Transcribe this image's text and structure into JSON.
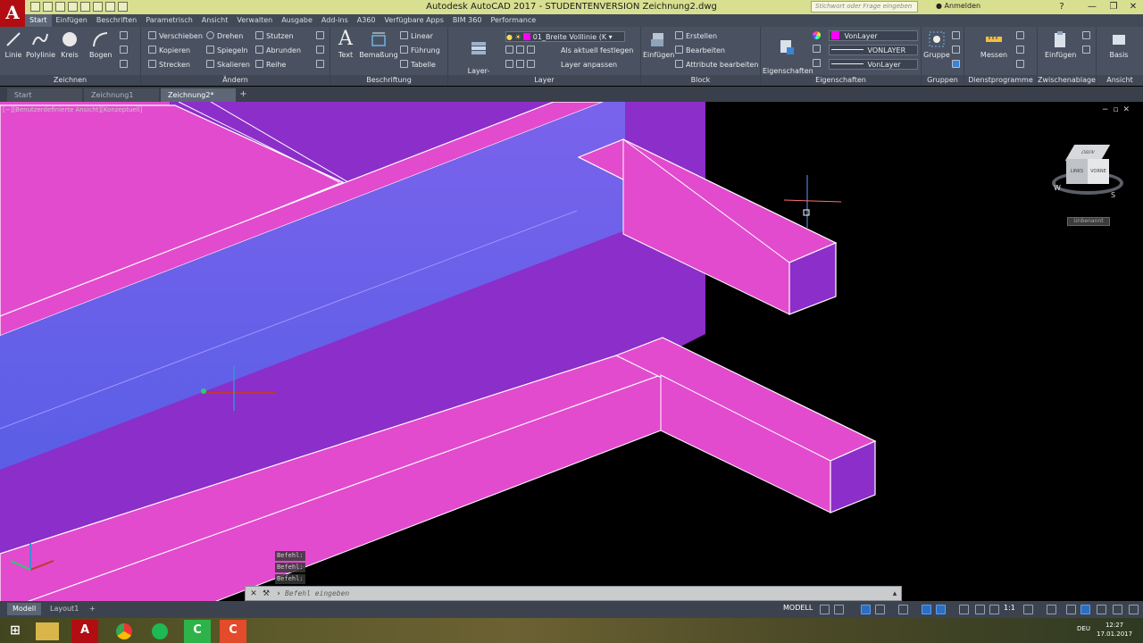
{
  "title_bar": {
    "app_logo": "A",
    "title": "Autodesk AutoCAD 2017 - STUDENTENVERSION    Zeichnung2.dwg",
    "search_placeholder": "Stichwort oder Frage eingeben",
    "signin_label": "Anmelden",
    "help_label": "?",
    "minimize": "—",
    "maximize": "❐",
    "close": "✕"
  },
  "ribbon_tabs": [
    "Start",
    "Einfügen",
    "Beschriften",
    "Parametrisch",
    "Ansicht",
    "Verwalten",
    "Ausgabe",
    "Add-ins",
    "A360",
    "Verfügbare Apps",
    "BIM 360",
    "Performance"
  ],
  "ribbon": {
    "zeichnen": {
      "title": "Zeichnen",
      "linie": "Linie",
      "polylinie": "Polylinie",
      "kreis": "Kreis",
      "bogen": "Bogen"
    },
    "aendern": {
      "title": "Ändern",
      "verschieben": "Verschieben",
      "drehen": "Drehen",
      "stutzen": "Stutzen",
      "kopieren": "Kopieren",
      "spiegeln": "Spiegeln",
      "abrunden": "Abrunden",
      "strecken": "Strecken",
      "skalieren": "Skalieren",
      "reihe": "Reihe"
    },
    "beschriftung": {
      "title": "Beschriftung",
      "text": "Text",
      "bemassung": "Bemaßung",
      "linear": "Linear",
      "fuehrung": "Führung",
      "tabelle": "Tabelle"
    },
    "layer": {
      "title": "Layer",
      "layer_eigenschaften": "Layer-\nEigenschaften",
      "current_layer": "01_Breite Volllinie (K",
      "als_aktuell": "Als aktuell festlegen",
      "layer_anpassen": "Layer anpassen"
    },
    "block": {
      "title": "Block",
      "einfuegen": "Einfügen",
      "erstellen": "Erstellen",
      "bearbeiten": "Bearbeiten",
      "attribute": "Attribute bearbeiten"
    },
    "eigenschaften": {
      "title": "Eigenschaften",
      "eig_anpassen": "Eigenschaften\nanpassen",
      "color": "VonLayer",
      "linetype": "VONLAYER",
      "lineweight": "VonLayer"
    },
    "gruppen": {
      "title": "Gruppen",
      "gruppe": "Gruppe"
    },
    "dienstprogramme": {
      "title": "Dienstprogramme",
      "messen": "Messen"
    },
    "zwischenablage": {
      "title": "Zwischenablage",
      "einfuegen": "Einfügen"
    },
    "ansicht": {
      "title": "Ansicht",
      "basis": "Basis"
    }
  },
  "file_tabs": [
    "Start",
    "Zeichnung1",
    "Zeichnung2*"
  ],
  "viewport": {
    "label": "[−][Benutzerdefinierte Ansicht][Konzeptuell]",
    "viewcube_top": "OBEN",
    "viewcube_left": "LINKS",
    "viewcube_front": "VORNE",
    "compass_w": "W",
    "compass_s": "S",
    "unnamed_label": "Unbenannt"
  },
  "command": {
    "history": [
      "Befehl:",
      "Befehl:",
      "Befehl:"
    ],
    "placeholder": "Befehl eingeben"
  },
  "status": {
    "layout_tabs": [
      "Modell",
      "Layout1"
    ],
    "model_button": "MODELL",
    "scale": "1:1"
  },
  "taskbar": {
    "language": "DEU",
    "time": "12:27",
    "date": "17.01.2017"
  },
  "colors": {
    "magenta": "#e24bcd",
    "purple": "#8c2ec9",
    "blue_highlight": "#5a5ee6",
    "ribbon_bg": "#4a5261",
    "title_bg": "#d8df90"
  }
}
